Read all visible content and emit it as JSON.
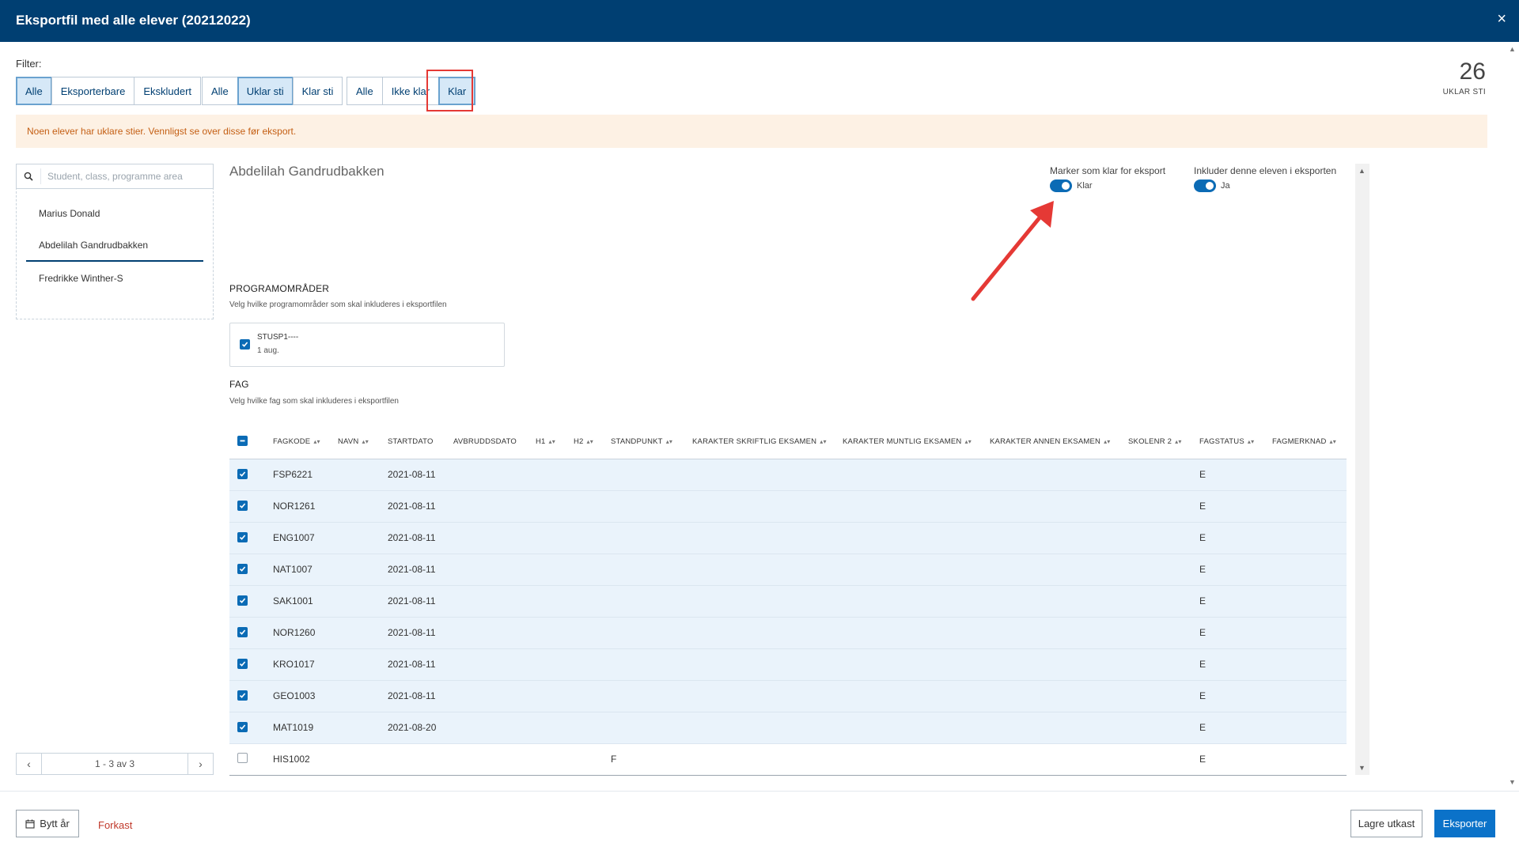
{
  "dialog": {
    "title": "Eksportfil med alle elever (20212022)",
    "close_symbol": "×"
  },
  "filter": {
    "label": "Filter:",
    "group1": [
      "Alle",
      "Eksporterbare",
      "Ekskludert"
    ],
    "group2": [
      "Alle",
      "Uklar sti",
      "Klar sti"
    ],
    "group3": [
      "Alle",
      "Ikke klar",
      "Klar"
    ],
    "active": {
      "group1": "Alle",
      "group2": "Uklar sti",
      "group3": "Klar"
    }
  },
  "counter": {
    "value": "26",
    "label": "UKLAR STI"
  },
  "warning": "Noen elever har uklare stier. Vennligst se over disse før eksport.",
  "search": {
    "placeholder": "Student, class, programme area"
  },
  "students": [
    "Marius Donald",
    "Abdelilah Gandrudbakken",
    "Fredrikke Winther-S"
  ],
  "selected_student": "Abdelilah Gandrudbakken",
  "pager": {
    "text": "1 - 3 av 3"
  },
  "detail": {
    "name": "Abdelilah Gandrudbakken",
    "toggle_ready": {
      "label": "Marker som klar for eksport",
      "value": "Klar",
      "on": true
    },
    "toggle_include": {
      "label": "Inkluder denne eleven i eksporten",
      "value": "Ja",
      "on": true
    }
  },
  "programomrader": {
    "title": "PROGRAMOMRÅDER",
    "subtitle": "Velg hvilke programområder som skal inkluderes i eksportfilen",
    "items": [
      {
        "code": "STUSP1----",
        "date": "1 aug.",
        "checked": true
      }
    ]
  },
  "fag": {
    "title": "FAG",
    "subtitle": "Velg hvilke fag som skal inkluderes i eksportfilen",
    "columns": [
      "FAGKODE",
      "NAVN",
      "STARTDATO",
      "AVBRUDDSDATO",
      "H1",
      "H2",
      "STANDPUNKT",
      "KARAKTER SKRIFTLIG EKSAMEN",
      "KARAKTER MUNTLIG EKSAMEN",
      "KARAKTER ANNEN EKSAMEN",
      "SKOLENR 2",
      "FAGSTATUS",
      "FAGMERKNAD"
    ],
    "rows": [
      {
        "checked": true,
        "fagkode": "FSP6221",
        "startdato": "2021-08-11",
        "standpunkt": "",
        "fagstatus": "E"
      },
      {
        "checked": true,
        "fagkode": "NOR1261",
        "startdato": "2021-08-11",
        "standpunkt": "",
        "fagstatus": "E"
      },
      {
        "checked": true,
        "fagkode": "ENG1007",
        "startdato": "2021-08-11",
        "standpunkt": "",
        "fagstatus": "E"
      },
      {
        "checked": true,
        "fagkode": "NAT1007",
        "startdato": "2021-08-11",
        "standpunkt": "",
        "fagstatus": "E"
      },
      {
        "checked": true,
        "fagkode": "SAK1001",
        "startdato": "2021-08-11",
        "standpunkt": "",
        "fagstatus": "E"
      },
      {
        "checked": true,
        "fagkode": "NOR1260",
        "startdato": "2021-08-11",
        "standpunkt": "",
        "fagstatus": "E"
      },
      {
        "checked": true,
        "fagkode": "KRO1017",
        "startdato": "2021-08-11",
        "standpunkt": "",
        "fagstatus": "E"
      },
      {
        "checked": true,
        "fagkode": "GEO1003",
        "startdato": "2021-08-11",
        "standpunkt": "",
        "fagstatus": "E"
      },
      {
        "checked": true,
        "fagkode": "MAT1019",
        "startdato": "2021-08-20",
        "standpunkt": "",
        "fagstatus": "E"
      },
      {
        "checked": false,
        "fagkode": "HIS1002",
        "startdato": "",
        "standpunkt": "F",
        "fagstatus": "E"
      }
    ]
  },
  "footer": {
    "bytt": "Bytt år",
    "forkast": "Forkast",
    "lagre": "Lagre utkast",
    "eksporter": "Eksporter"
  },
  "colors": {
    "header": "#003f72",
    "primary": "#0b72c9",
    "warning_bg": "#fdf1e4",
    "warning_text": "#c45f14",
    "highlight": "#e53935"
  }
}
